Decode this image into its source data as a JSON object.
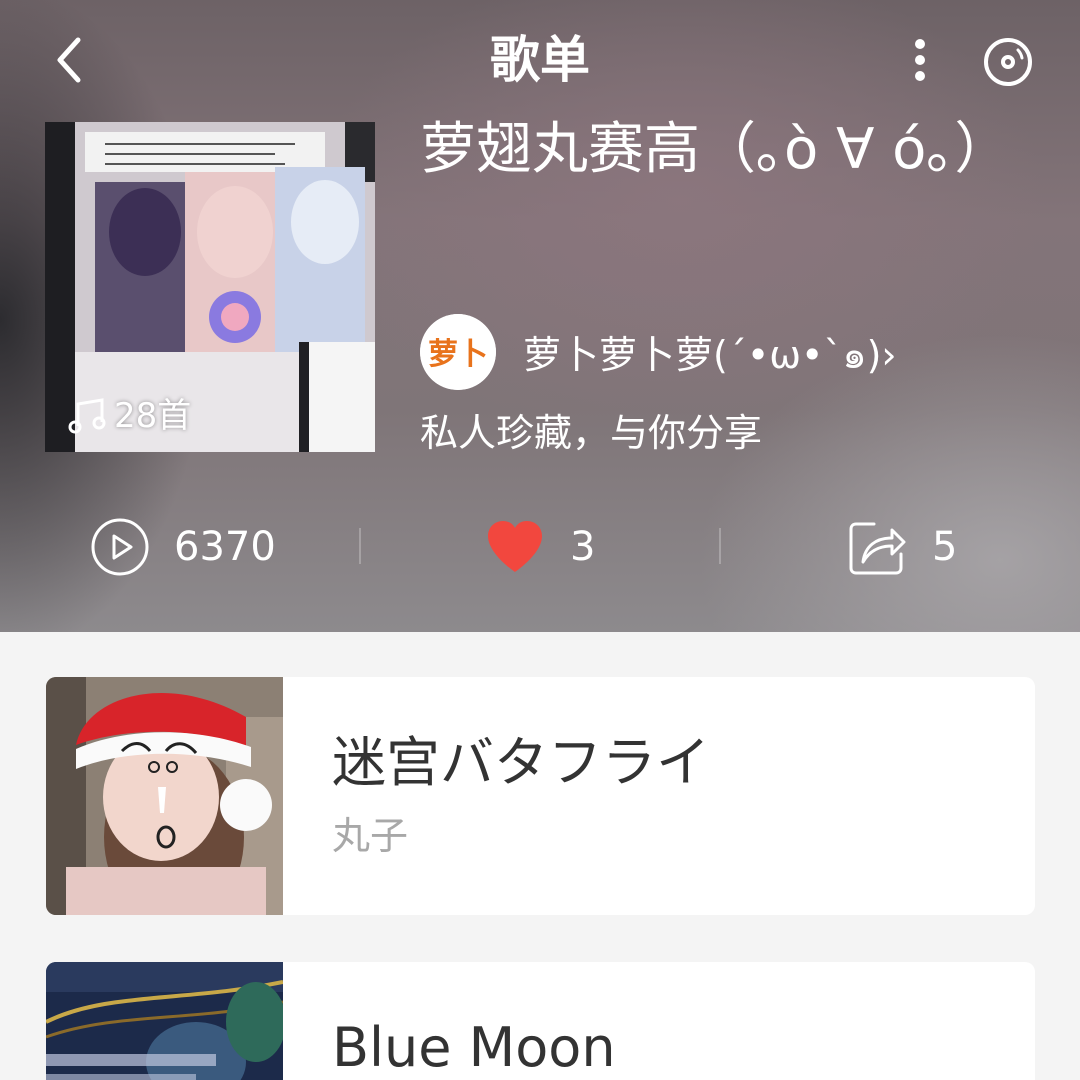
{
  "header": {
    "title": "歌单",
    "back_icon": "chevron-left-icon",
    "more_icon": "vertical-dots-icon",
    "disc_icon": "disc-icon"
  },
  "playlist": {
    "title": "萝翅丸赛高（｡ò ∀ ó｡）",
    "track_count": "28首",
    "creator": {
      "avatar_text": "萝卜",
      "name": "萝卜萝卜萝(´•ω•`๑)",
      "chevron": "›"
    },
    "description": "私人珍藏，与你分享"
  },
  "stats": {
    "plays": "6370",
    "likes": "3",
    "shares": "5"
  },
  "colors": {
    "accent_heart": "#f2473e",
    "avatar_text": "#e8731c"
  },
  "songs": [
    {
      "title": "迷宫バタフライ",
      "artist": "丸子"
    },
    {
      "title": "Blue Moon",
      "artist": ""
    }
  ]
}
